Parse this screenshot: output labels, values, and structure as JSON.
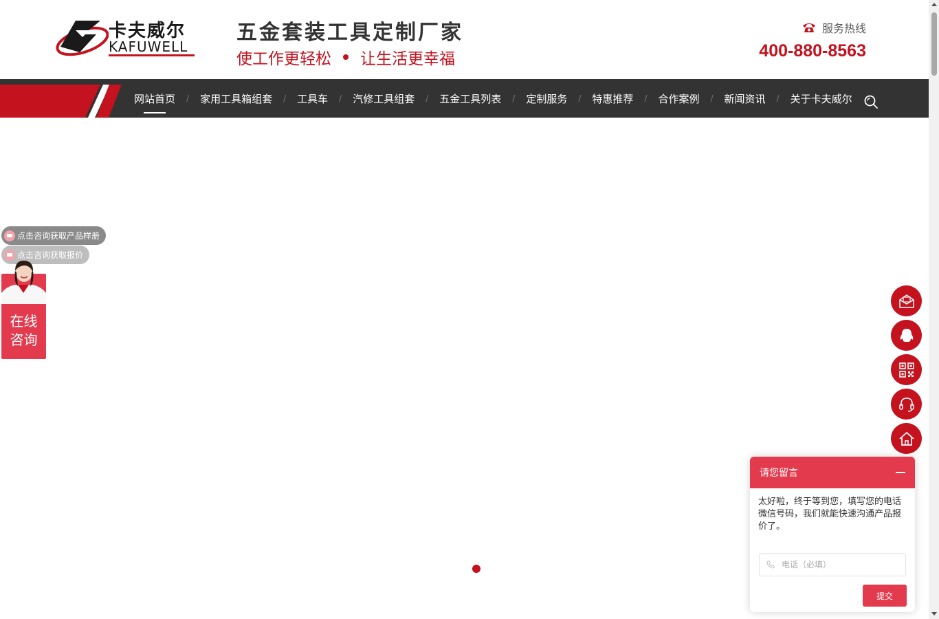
{
  "header": {
    "logo_cn": "卡夫威尔",
    "logo_en": "KAFUWELL",
    "slogan_title": "五金套装工具定制厂家",
    "slogan_left": "使工作更轻松",
    "slogan_right": "让生活更幸福",
    "hotline_label": "服务热线",
    "hotline_number": "400-880-8563"
  },
  "nav": {
    "items": [
      {
        "label": "网站首页",
        "active": true
      },
      {
        "label": "家用工具箱组套"
      },
      {
        "label": "工具车"
      },
      {
        "label": "汽修工具组套"
      },
      {
        "label": "五金工具列表"
      },
      {
        "label": "定制服务"
      },
      {
        "label": "特惠推荐"
      },
      {
        "label": "合作案例"
      },
      {
        "label": "新闻资讯"
      },
      {
        "label": "关于卡夫威尔"
      }
    ],
    "separator": "/"
  },
  "left_consult": {
    "pill_1": "点击咨询获取产品样册",
    "pill_2": "点击咨询获取报价",
    "card_line_1": "在线",
    "card_line_2": "咨询"
  },
  "float_buttons": [
    "mail-icon",
    "qq-icon",
    "qrcode-icon",
    "headset-icon",
    "home-icon"
  ],
  "message_widget": {
    "title": "请您留言",
    "body": "太好啦，终于等到您，填写您的电话微信号码，我们就能快速沟通产品报价了。",
    "phone_placeholder": "电话（必填）",
    "submit_label": "提交"
  },
  "colors": {
    "brand_red": "#c4121e",
    "widget_red": "#e33a4d",
    "nav_bg": "#333333"
  }
}
